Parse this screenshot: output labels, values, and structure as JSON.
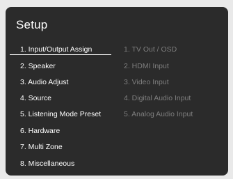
{
  "title": "Setup",
  "main_menu": [
    "1. Input/Output Assign",
    "2. Speaker",
    "3. Audio Adjust",
    "4. Source",
    "5. Listening Mode Preset",
    "6. Hardware",
    "7. Multi Zone",
    "8. Miscellaneous"
  ],
  "sub_menu": [
    "1. TV Out / OSD",
    "2. HDMI Input",
    "3. Video Input",
    "4. Digital Audio Input",
    "5. Analog Audio Input"
  ],
  "colors": {
    "frame_bg": "#e9e9e9",
    "screen_bg": "#2b2b2b",
    "active_text": "#ffffff",
    "inactive_text": "#7e7e7e"
  }
}
